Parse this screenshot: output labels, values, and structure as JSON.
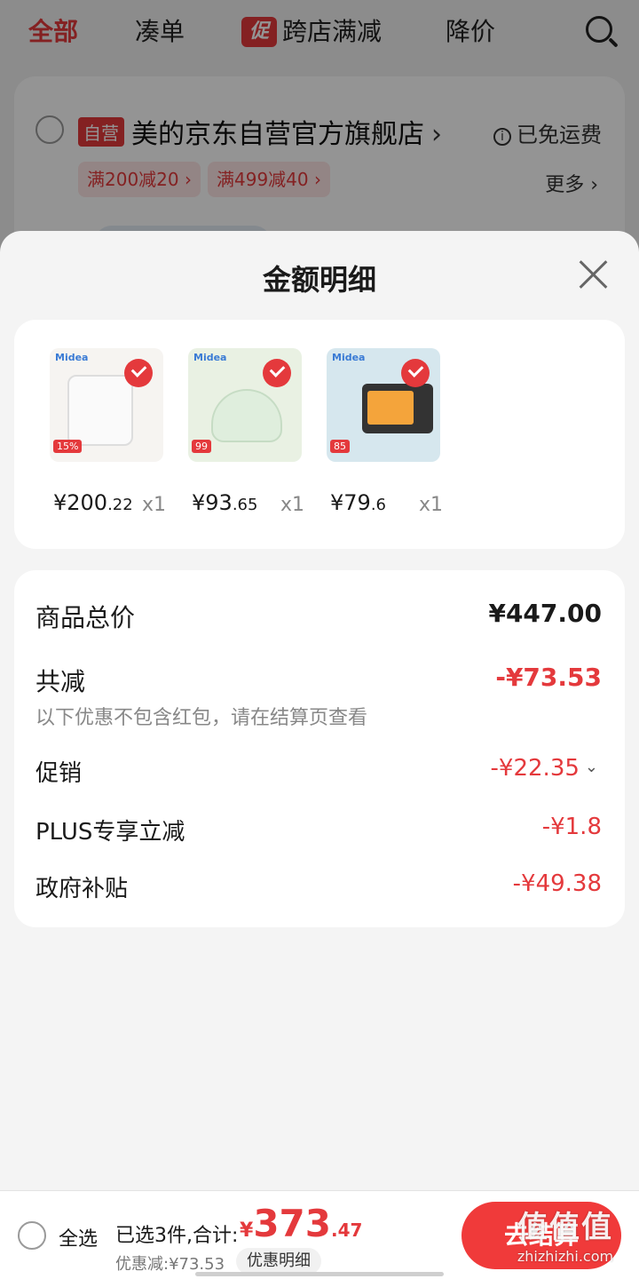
{
  "topnav": {
    "tabs": [
      "全部",
      "凑单",
      "跨店满减",
      "降价"
    ],
    "promo_badge": "促",
    "search_icon": "search-icon"
  },
  "store": {
    "tag": "自营",
    "name": "美的京东自营官方旗舰店",
    "free_shipping": "已免运费",
    "coupons": [
      "满200减20",
      "满499减40"
    ],
    "more": "更多"
  },
  "sheet": {
    "title": "金额明细",
    "products": [
      {
        "price_int": "¥200",
        "price_dec": ".22",
        "qty": "x1",
        "brand": "Midea"
      },
      {
        "price_int": "¥93",
        "price_dec": ".65",
        "qty": "x1",
        "brand": "Midea"
      },
      {
        "price_int": "¥79",
        "price_dec": ".6",
        "qty": "x1",
        "brand": "Midea"
      }
    ],
    "summary": {
      "total_label": "商品总价",
      "total_value": "¥447.00",
      "reduce_label": "共减",
      "reduce_value": "-¥73.53",
      "reduce_note": "以下优惠不包含红包，请在结算页查看",
      "items": [
        {
          "label": "促销",
          "value": "-¥22.35"
        },
        {
          "label": "PLUS专享立减",
          "value": "-¥1.8"
        },
        {
          "label": "政府补贴",
          "value": "-¥49.38"
        }
      ]
    }
  },
  "bottom": {
    "select_all": "全选",
    "selected": "已选3件,合计:",
    "total_cur": "¥",
    "total_int": "373",
    "total_dec": ".47",
    "discount": "优惠减:¥73.53",
    "detail": "优惠明细",
    "checkout": "去结算"
  },
  "watermark": {
    "main": "值值值",
    "sub": "zhizhizhi.com"
  },
  "colors": {
    "accent": "#e4393c",
    "checkout": "#f03a3a"
  }
}
